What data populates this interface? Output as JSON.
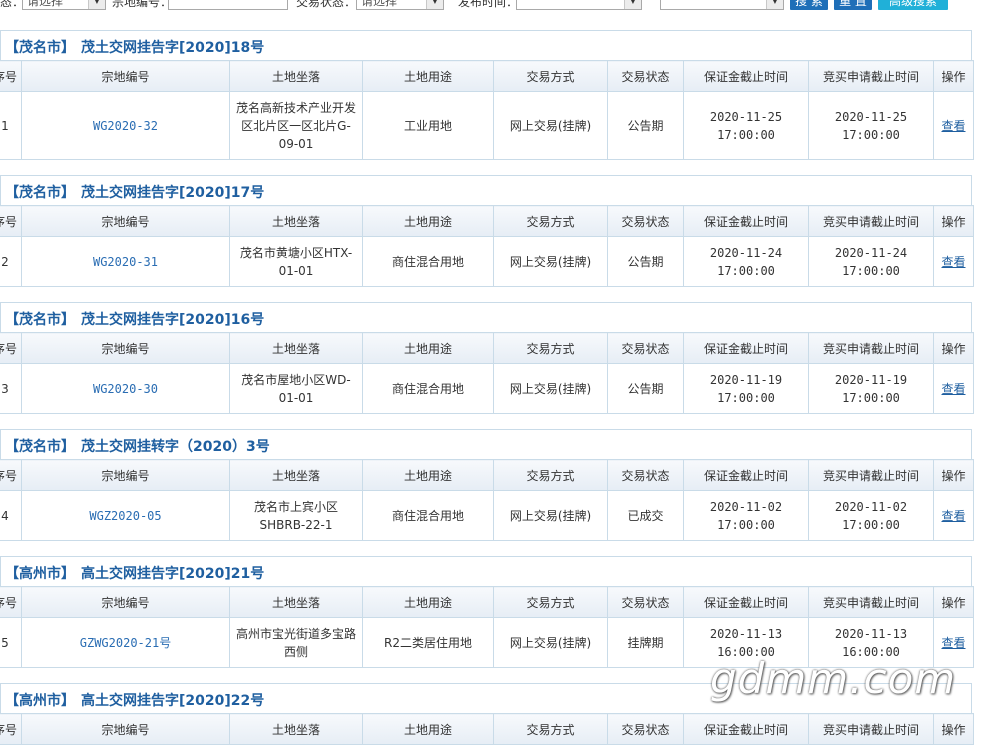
{
  "filter_bar": {
    "label_1": "态：",
    "select_1": "请选择",
    "label_2": "宗地编号：",
    "label_3": "交易状态：",
    "select_3": "请选择",
    "label_4": "发布时间：",
    "search_btn": "搜 索",
    "reset_btn": "重 置",
    "advanced_btn": "高级搜索"
  },
  "columns": [
    "序号",
    "宗地编号",
    "土地坐落",
    "土地用途",
    "交易方式",
    "交易状态",
    "保证金截止时间",
    "竞买申请截止时间",
    "操作"
  ],
  "notices": [
    {
      "city": "【茂名市】",
      "title": "茂土交网挂告字[2020]18号",
      "row": {
        "no": "1",
        "code": "WG2020-32",
        "location": "茂名高新技术产业开发区北片区一区北片G-09-01",
        "usage": "工业用地",
        "method": "网上交易(挂牌)",
        "status": "公告期",
        "deposit_deadline": "2020-11-25 17:00:00",
        "apply_deadline": "2020-11-25 17:00:00",
        "action": "查看"
      }
    },
    {
      "city": "【茂名市】",
      "title": "茂土交网挂告字[2020]17号",
      "row": {
        "no": "2",
        "code": "WG2020-31",
        "location": "茂名市黄塘小区HTX-01-01",
        "usage": "商住混合用地",
        "method": "网上交易(挂牌)",
        "status": "公告期",
        "deposit_deadline": "2020-11-24 17:00:00",
        "apply_deadline": "2020-11-24 17:00:00",
        "action": "查看"
      }
    },
    {
      "city": "【茂名市】",
      "title": "茂土交网挂告字[2020]16号",
      "row": {
        "no": "3",
        "code": "WG2020-30",
        "location": "茂名市屋地小区WD-01-01",
        "usage": "商住混合用地",
        "method": "网上交易(挂牌)",
        "status": "公告期",
        "deposit_deadline": "2020-11-19 17:00:00",
        "apply_deadline": "2020-11-19 17:00:00",
        "action": "查看"
      }
    },
    {
      "city": "【茂名市】",
      "title": "茂土交网挂转字（2020）3号",
      "row": {
        "no": "4",
        "code": "WGZ2020-05",
        "location": "茂名市上宾小区SHBRB-22-1",
        "usage": "商住混合用地",
        "method": "网上交易(挂牌)",
        "status": "已成交",
        "deposit_deadline": "2020-11-02 17:00:00",
        "apply_deadline": "2020-11-02 17:00:00",
        "action": "查看"
      }
    },
    {
      "city": "【高州市】",
      "title": "高土交网挂告字[2020]21号",
      "row": {
        "no": "5",
        "code": "GZWG2020-21号",
        "location": "高州市宝光街道多宝路西侧",
        "usage": "R2二类居住用地",
        "method": "网上交易(挂牌)",
        "status": "挂牌期",
        "deposit_deadline": "2020-11-13 16:00:00",
        "apply_deadline": "2020-11-13 16:00:00",
        "action": "查看"
      }
    },
    {
      "city": "【高州市】",
      "title": "高土交网挂告字[2020]22号"
    }
  ],
  "watermark": "gdmm.com"
}
